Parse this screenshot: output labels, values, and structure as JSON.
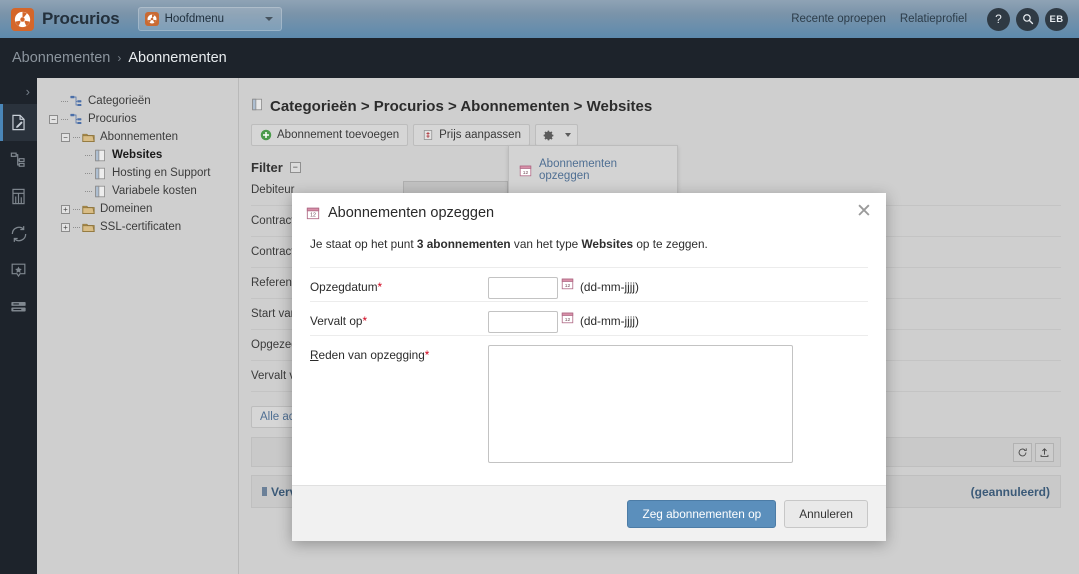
{
  "header": {
    "brand": "Procurios",
    "menu_label": "Hoofdmenu",
    "links": [
      "Recente oproepen",
      "Relatieprofiel"
    ],
    "help_icon": "question-mark-icon",
    "search_icon": "search-icon",
    "avatar_initials": "EB"
  },
  "breadcrumb": {
    "parent": "Abonnementen",
    "separator": "›",
    "current": "Abonnementen"
  },
  "rail": {
    "toggle_icon": "chevron-right-icon",
    "items": [
      {
        "name": "document-edit-icon",
        "active": true
      },
      {
        "name": "sitemap-icon",
        "active": false
      },
      {
        "name": "table-report-icon",
        "active": false
      },
      {
        "name": "refresh-sync-icon",
        "active": false
      },
      {
        "name": "star-badge-icon",
        "active": false
      },
      {
        "name": "server-stack-icon",
        "active": false
      }
    ]
  },
  "tree": {
    "nodes": [
      {
        "label": "Categorieën",
        "depth": 0,
        "expander": "",
        "icon": "sitemap-icon",
        "selected": false
      },
      {
        "label": "Procurios",
        "depth": 0,
        "expander": "−",
        "icon": "sitemap-icon",
        "selected": false
      },
      {
        "label": "Abonnementen",
        "depth": 1,
        "expander": "−",
        "icon": "folder-icon",
        "selected": false
      },
      {
        "label": "Websites",
        "depth": 2,
        "expander": "",
        "icon": "page-icon",
        "selected": true
      },
      {
        "label": "Hosting en Support",
        "depth": 2,
        "expander": "",
        "icon": "page-icon",
        "selected": false
      },
      {
        "label": "Variabele kosten",
        "depth": 2,
        "expander": "",
        "icon": "page-icon",
        "selected": false
      },
      {
        "label": "Domeinen",
        "depth": 1,
        "expander": "+",
        "icon": "folder-icon",
        "selected": false
      },
      {
        "label": "SSL-certificaten",
        "depth": 1,
        "expander": "+",
        "icon": "folder-icon",
        "selected": false
      }
    ]
  },
  "main": {
    "page_title": "Categorieën > Procurios > Abonnementen > Websites",
    "page_title_icon": "page-icon",
    "toolbar": {
      "add_label": "Abonnement toevoegen",
      "add_icon": "plus-circle-icon",
      "price_label": "Prijs aanpassen",
      "price_icon": "price-tag-icon",
      "gear_icon": "gear-icon",
      "gear_caret_icon": "chevron-down-icon"
    },
    "dropdown": {
      "items": [
        {
          "label": "Abonnementen opzeggen",
          "icon": "calendar-icon"
        }
      ]
    },
    "filter": {
      "title": "Filter",
      "collapse_icon": "minus-box-icon",
      "rows": [
        {
          "label": "Debiteur"
        },
        {
          "label": "Contract"
        },
        {
          "label": "Contract"
        },
        {
          "label": "Referentie"
        },
        {
          "label": "Start van"
        },
        {
          "label": "Opgezegd"
        },
        {
          "label": "Vervalt van"
        }
      ]
    },
    "all_actions_label": "Alle acties",
    "grid_toolbar": {
      "refresh_icon": "refresh-icon",
      "export_icon": "export-icon"
    },
    "grid_row": {
      "left_label": "Vervallen",
      "right_label": "(geannuleerd)"
    }
  },
  "modal": {
    "title": "Abonnementen opzeggen",
    "title_icon": "calendar-icon",
    "close_icon": "close-icon",
    "intro": {
      "part1": "Je staat op het punt ",
      "bold1": "3 abonnementen",
      "part2": " van het type ",
      "bold2": "Websites",
      "part3": " op te zeggen."
    },
    "fields": [
      {
        "label": "Opzegdatum",
        "required_mark": "*",
        "underline_first": false,
        "type": "date",
        "value": "",
        "placeholder": "",
        "hint": "(dd-mm-jjjj)",
        "calendar_icon": "calendar-icon"
      },
      {
        "label": "Vervalt op",
        "required_mark": "*",
        "underline_first": false,
        "type": "date",
        "value": "",
        "placeholder": "",
        "hint": "(dd-mm-jjjj)",
        "calendar_icon": "calendar-icon"
      },
      {
        "label": "Reden van opzegging",
        "required_mark": "*",
        "underline_first": true,
        "type": "textarea",
        "value": "",
        "placeholder": "",
        "hint": "",
        "calendar_icon": ""
      }
    ],
    "submit_label": "Zeg abonnementen op",
    "cancel_label": "Annuleren"
  },
  "colors": {
    "header_top": "#8fa3b5",
    "header_bottom": "#5d8aad",
    "dark_bar": "#1d232b",
    "canvas": "#cfcfcf",
    "accent_orange": "#d4662a",
    "primary_button": "#5b8fbc",
    "required_red": "#d0021b",
    "link_blue": "#4f6f93"
  }
}
